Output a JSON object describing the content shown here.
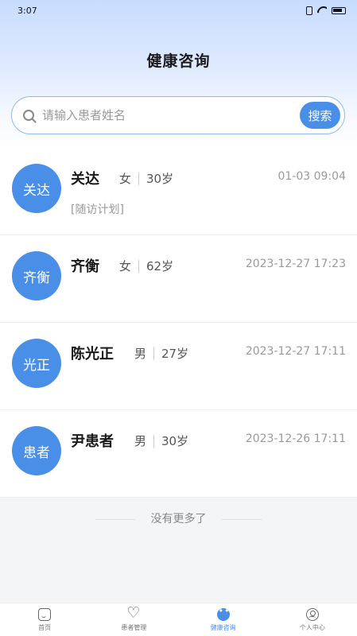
{
  "status": {
    "time": "3:07"
  },
  "page": {
    "title": "健康咨询"
  },
  "search": {
    "placeholder": "请输入患者姓名",
    "button_label": "搜索"
  },
  "patients": [
    {
      "avatar": "关达",
      "name": "关达",
      "gender": "女",
      "age": "30岁",
      "datetime": "01-03 09:04",
      "tag": "[随访计划]"
    },
    {
      "avatar": "齐衡",
      "name": "齐衡",
      "gender": "女",
      "age": "62岁",
      "datetime": "2023-12-27 17:23"
    },
    {
      "avatar": "光正",
      "name": "陈光正",
      "gender": "男",
      "age": "27岁",
      "datetime": "2023-12-27 17:11"
    },
    {
      "avatar": "患者",
      "name": "尹患者",
      "gender": "男",
      "age": "30岁",
      "datetime": "2023-12-26 17:11"
    }
  ],
  "list_end": "没有更多了",
  "tabbar": [
    {
      "label": "首页",
      "icon": "home-icon"
    },
    {
      "label": "患者管理",
      "icon": "heart-icon"
    },
    {
      "label": "健康咨询",
      "icon": "chat-icon",
      "active": true
    },
    {
      "label": "个人中心",
      "icon": "user-icon"
    }
  ],
  "colors": {
    "accent": "#4a8fe7"
  }
}
